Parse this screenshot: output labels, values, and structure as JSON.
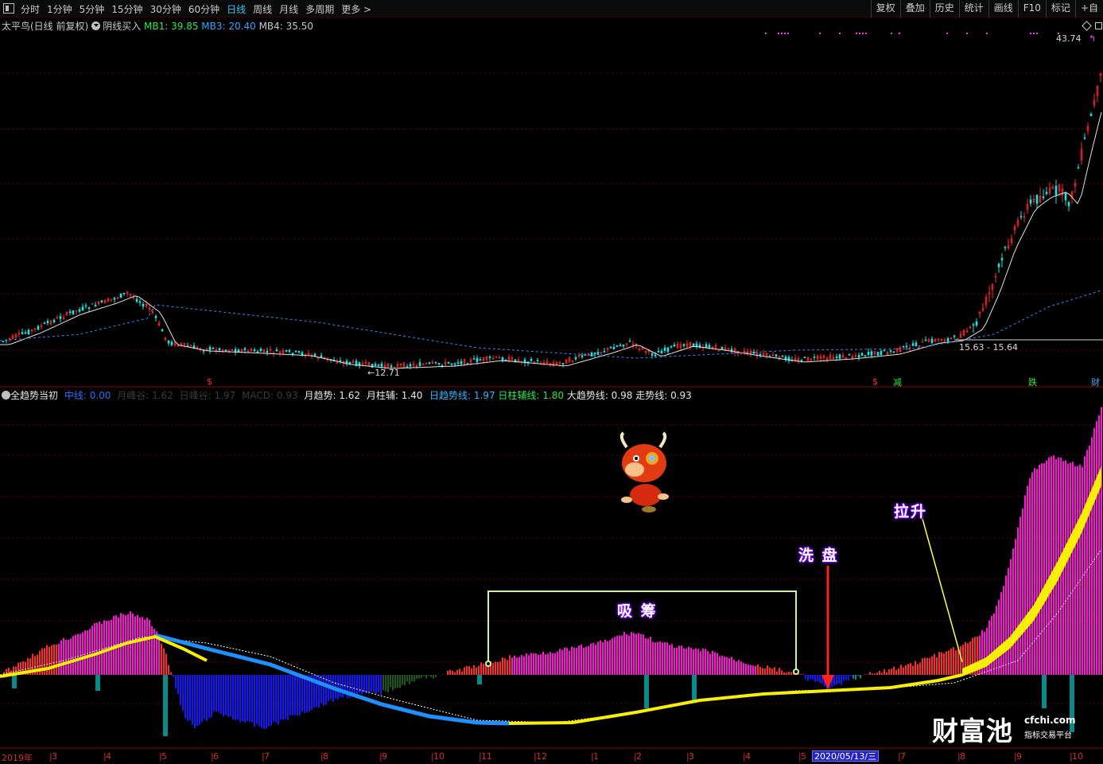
{
  "toolbar": {
    "tabs": [
      "分时",
      "1分钟",
      "5分钟",
      "15分钟",
      "30分钟",
      "60分钟",
      "日线",
      "周线",
      "月线",
      "多周期",
      "更多 >"
    ],
    "active_tab": "日线",
    "buttons": [
      "复权",
      "叠加",
      "历史",
      "统计",
      "画线",
      "F10",
      "标记",
      "+自"
    ]
  },
  "main_header": {
    "title": "太平鸟(日线 前复权)",
    "indicator_name": "阴线买入",
    "mb1": "MB1: 39.85",
    "mb3": "MB3: 20.40",
    "mb4": "MB4: 35.50"
  },
  "price_labels": {
    "high": "43.74",
    "low": "←12.71",
    "range": "15.63 - 15.64"
  },
  "signal_marks": [
    "$",
    "$",
    "减",
    "跌",
    "财"
  ],
  "indicator_header": {
    "name": "全趋势当初",
    "zhongxian": "中线: 0.00",
    "yuefenggu": "月峰谷: 1.62",
    "rifenggu": "日峰谷: 1.97",
    "macd": "MACD: 0.93",
    "yuequshi": "月趋势: 1.62",
    "yuezhufu": "月柱辅: 1.40",
    "riqushixian": "日趋势线: 1.97",
    "rizhufuxian": "日柱辅线: 1.80",
    "daqushixian": "大趋势线: 0.98",
    "zoushixian": "走势线: 0.93"
  },
  "annotations": {
    "xichou": "吸 筹",
    "xipan": "洗 盘",
    "lasheng": "拉升"
  },
  "x_axis": {
    "labels": [
      "2019年",
      "3",
      "4",
      "5",
      "6",
      "7",
      "8",
      "9",
      "10",
      "11",
      "12",
      "1",
      "2",
      "3",
      "4",
      "5",
      "7",
      "8",
      "9",
      "10"
    ],
    "cursor_date": "2020/05/13/三"
  },
  "watermark": {
    "name": "财富池",
    "domain": "cfchi.com",
    "tagline": "指标交易平台"
  },
  "colors": {
    "up": "#ff2a2a",
    "down": "#19e6e6",
    "ma_white": "#e0e0e0",
    "ma_blue_dash": "#2f8bff",
    "magenta_fill": "#ff14d8",
    "blue_fill": "#1616ff",
    "teal_fill": "#0a8a8a",
    "yellow_line": "#f8f000"
  }
}
